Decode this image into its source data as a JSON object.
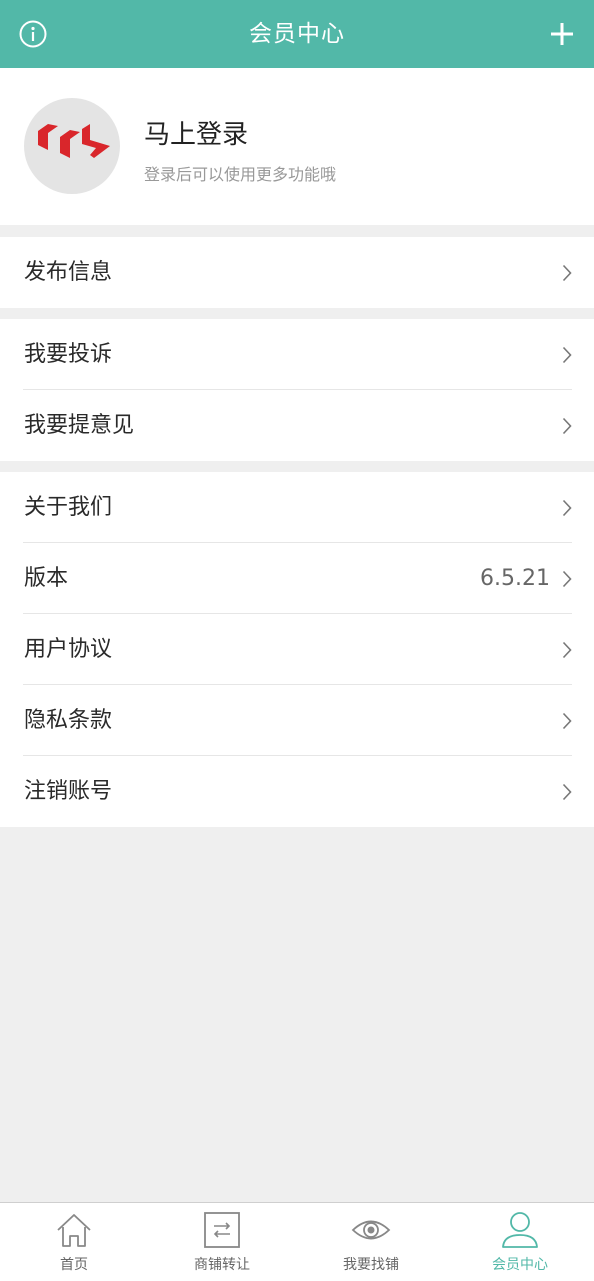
{
  "header": {
    "title": "会员中心"
  },
  "profile": {
    "login_label": "马上登录",
    "subtitle": "登录后可以使用更多功能哦"
  },
  "groups": [
    {
      "items": [
        {
          "label": "发布信息"
        }
      ]
    },
    {
      "items": [
        {
          "label": "我要投诉"
        },
        {
          "label": "我要提意见"
        }
      ]
    },
    {
      "items": [
        {
          "label": "关于我们"
        },
        {
          "label": "版本",
          "value": "6.5.21"
        },
        {
          "label": "用户协议"
        },
        {
          "label": "隐私条款"
        },
        {
          "label": "注销账号"
        }
      ]
    }
  ],
  "tabbar": {
    "items": [
      {
        "label": "首页",
        "icon": "home-icon"
      },
      {
        "label": "商铺转让",
        "icon": "transfer-icon"
      },
      {
        "label": "我要找铺",
        "icon": "eye-icon"
      },
      {
        "label": "会员中心",
        "icon": "user-icon"
      }
    ],
    "active_index": 3
  },
  "colors": {
    "accent": "#52b8a8",
    "background": "#efefef",
    "logo_red": "#d9262b"
  }
}
